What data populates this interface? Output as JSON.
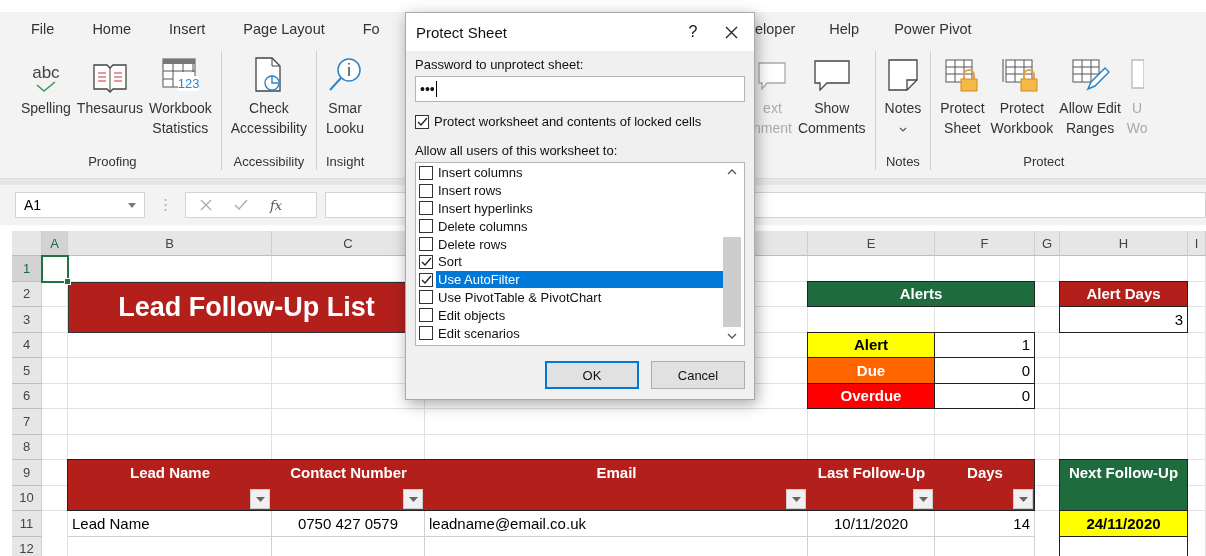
{
  "ribbon": {
    "tabs": [
      "File",
      "Home",
      "Insert",
      "Page Layout",
      "Fo"
    ],
    "tabs_right": [
      "eloper",
      "Help",
      "Power Pivot"
    ],
    "groups": [
      {
        "label": "Proofing",
        "buttons": [
          {
            "kind": "spelling",
            "glyph": "abc",
            "lines": [
              "Spelling"
            ],
            "disabled": false,
            "dropdown": false
          },
          {
            "kind": "thesaurus",
            "lines": [
              "Thesaurus"
            ],
            "disabled": false,
            "dropdown": false
          },
          {
            "kind": "statistics",
            "glyph": "123",
            "lines": [
              "Workbook",
              "Statistics"
            ],
            "disabled": false,
            "dropdown": false
          }
        ]
      },
      {
        "label": "Accessibility",
        "buttons": [
          {
            "kind": "accessibility",
            "lines": [
              "Check",
              "Accessibility"
            ],
            "disabled": false,
            "dropdown": false
          }
        ]
      },
      {
        "label": "Insight",
        "buttons": [
          {
            "kind": "lookup",
            "lines": [
              "Smar",
              "Looku"
            ],
            "disabled": false,
            "dropdown": false
          }
        ]
      }
    ],
    "groups_right": [
      {
        "buttons": [
          {
            "kind": "comment-next",
            "lines": [
              "ext",
              "nment"
            ],
            "disabled": true,
            "dropdown": false
          },
          {
            "kind": "comment",
            "lines": [
              "Show",
              "Comments"
            ],
            "disabled": false,
            "dropdown": false
          }
        ]
      },
      {
        "label": "Notes",
        "buttons": [
          {
            "kind": "note",
            "lines": [
              "Notes"
            ],
            "disabled": false,
            "dropdown": true
          }
        ]
      },
      {
        "label": "Protect",
        "buttons": [
          {
            "kind": "protect-sheet",
            "lines": [
              "Protect",
              "Sheet"
            ],
            "disabled": false,
            "dropdown": false
          },
          {
            "kind": "protect-workbook",
            "lines": [
              "Protect",
              "Workbook"
            ],
            "disabled": false,
            "dropdown": false
          },
          {
            "kind": "allow-edit",
            "lines": [
              "Allow Edit",
              "Ranges"
            ],
            "disabled": false,
            "dropdown": false
          },
          {
            "kind": "unprotect",
            "lines": [
              "U",
              "Wo"
            ],
            "disabled": true,
            "dropdown": false
          }
        ]
      }
    ]
  },
  "formula_bar": {
    "name_box": "A1",
    "function_label": "fx"
  },
  "sheet": {
    "columns": [
      "A",
      "B",
      "C",
      "E",
      "F",
      "G",
      "H",
      "I"
    ],
    "rows": [
      "1",
      "2",
      "3",
      "4",
      "5",
      "6",
      "7",
      "8",
      "9",
      "10",
      "11",
      "12"
    ],
    "title": "Lead Follow-Up List",
    "alerts": {
      "header": "Alerts",
      "items": [
        {
          "label": "Alert",
          "count": "1",
          "color": "#ffff00"
        },
        {
          "label": "Due",
          "count": "0",
          "color": "#ff6600"
        },
        {
          "label": "Overdue",
          "count": "0",
          "color": "#ff0000"
        }
      ]
    },
    "alert_days": {
      "header": "Alert Days",
      "value": "3"
    },
    "table": {
      "columns": [
        "Lead Name",
        "Contact Number",
        "Email",
        "Last Follow-Up",
        "Days"
      ],
      "rows": [
        [
          "Lead Name",
          "0750 427 0579",
          "leadname@email.co.uk",
          "10/11/2020",
          "14"
        ]
      ]
    },
    "next_follow_up": {
      "header": "Next Follow-Up",
      "values": [
        {
          "text": "24/11/2020",
          "color": "#ffff00"
        }
      ]
    }
  },
  "dialog": {
    "title": "Protect Sheet",
    "help": "?",
    "password_label": "Password to unprotect sheet:",
    "password": "•••",
    "protect_option": {
      "label": "Protect worksheet and contents of locked cells",
      "checked": true
    },
    "allow_label": "Allow all users of this worksheet to:",
    "permissions": [
      {
        "label": "Insert columns",
        "checked": false,
        "selected": false
      },
      {
        "label": "Insert rows",
        "checked": false,
        "selected": false
      },
      {
        "label": "Insert hyperlinks",
        "checked": false,
        "selected": false
      },
      {
        "label": "Delete columns",
        "checked": false,
        "selected": false
      },
      {
        "label": "Delete rows",
        "checked": false,
        "selected": false
      },
      {
        "label": "Sort",
        "checked": true,
        "selected": false
      },
      {
        "label": "Use AutoFilter",
        "checked": true,
        "selected": true
      },
      {
        "label": "Use PivotTable & PivotChart",
        "checked": false,
        "selected": false
      },
      {
        "label": "Edit objects",
        "checked": false,
        "selected": false
      },
      {
        "label": "Edit scenarios",
        "checked": false,
        "selected": false
      }
    ],
    "buttons": [
      {
        "label": "OK",
        "default": true
      },
      {
        "label": "Cancel",
        "default": false
      }
    ]
  }
}
